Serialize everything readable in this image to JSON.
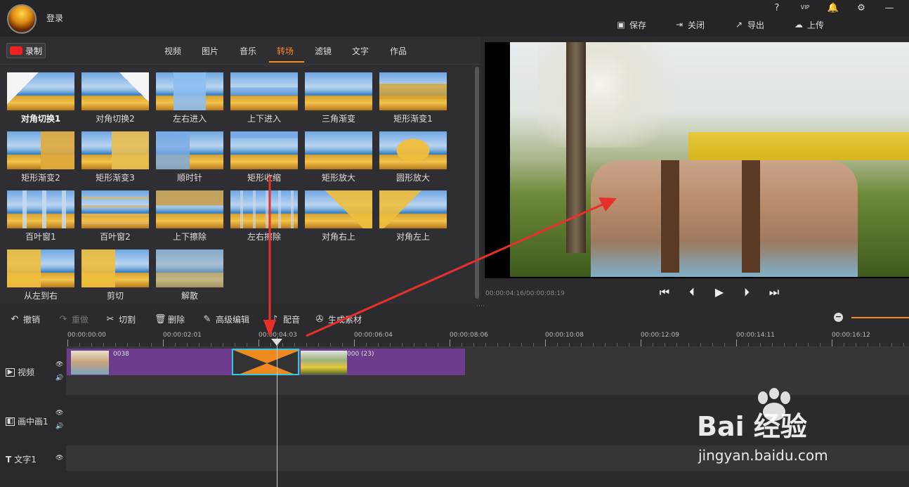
{
  "app": {
    "login": "登录"
  },
  "top_icons": {
    "help": "?",
    "vip": "VIP"
  },
  "top_buttons": [
    {
      "label": "保存",
      "icon": "save-icon"
    },
    {
      "label": "关闭",
      "icon": "exit-icon"
    },
    {
      "label": "导出",
      "icon": "export-icon"
    },
    {
      "label": "上传",
      "icon": "upload-icon"
    }
  ],
  "record_label": "录制",
  "tabs": [
    "视频",
    "图片",
    "音乐",
    "转场",
    "滤镜",
    "文字",
    "作品"
  ],
  "active_tab": "转场",
  "transitions": [
    "对角切换1",
    "对角切换2",
    "左右进入",
    "上下进入",
    "三角渐变",
    "矩形渐变1",
    "矩形渐变2",
    "矩形渐变3",
    "顺时针",
    "矩形收缩",
    "矩形放大",
    "圆形放大",
    "百叶窗1",
    "百叶窗2",
    "上下擦除",
    "左右擦除",
    "对角右上",
    "对角左上",
    "从左到右",
    "剪切",
    "解散"
  ],
  "selected_transition": "对角切换1",
  "preview": {
    "time": "00:00:04:16/00:00:08:19"
  },
  "toolbar": [
    {
      "label": "撤销",
      "icon": "undo-icon",
      "enabled": true
    },
    {
      "label": "重做",
      "icon": "redo-icon",
      "enabled": false
    },
    {
      "label": "切割",
      "icon": "scissors-icon",
      "enabled": true
    },
    {
      "label": "删除",
      "icon": "trash-icon",
      "enabled": true
    },
    {
      "label": "高级编辑",
      "icon": "pencil-icon",
      "enabled": true
    },
    {
      "label": "配音",
      "icon": "mic-icon",
      "enabled": true
    },
    {
      "label": "生成素材",
      "icon": "film-reel-icon",
      "enabled": true
    }
  ],
  "ruler": [
    "00:00:00:00",
    "00:00:02:01",
    "00:00:04:03",
    "00:00:06:04",
    "00:00:08:06",
    "00:00:10:08",
    "00:00:12:09",
    "00:00:14:11",
    "00:00:16:12"
  ],
  "tracks": [
    "视频",
    "画中画1",
    "文字1"
  ],
  "clips": {
    "clip1": "0038",
    "clip2": "000 (23)"
  },
  "watermark": {
    "brand": "Bai 经验",
    "url": "jingyan.baidu.com"
  },
  "colors": {
    "accent": "#ff8a1a",
    "clip": "#6c3d8a",
    "selection": "#33c7e6",
    "arrow": "#e8302a"
  }
}
